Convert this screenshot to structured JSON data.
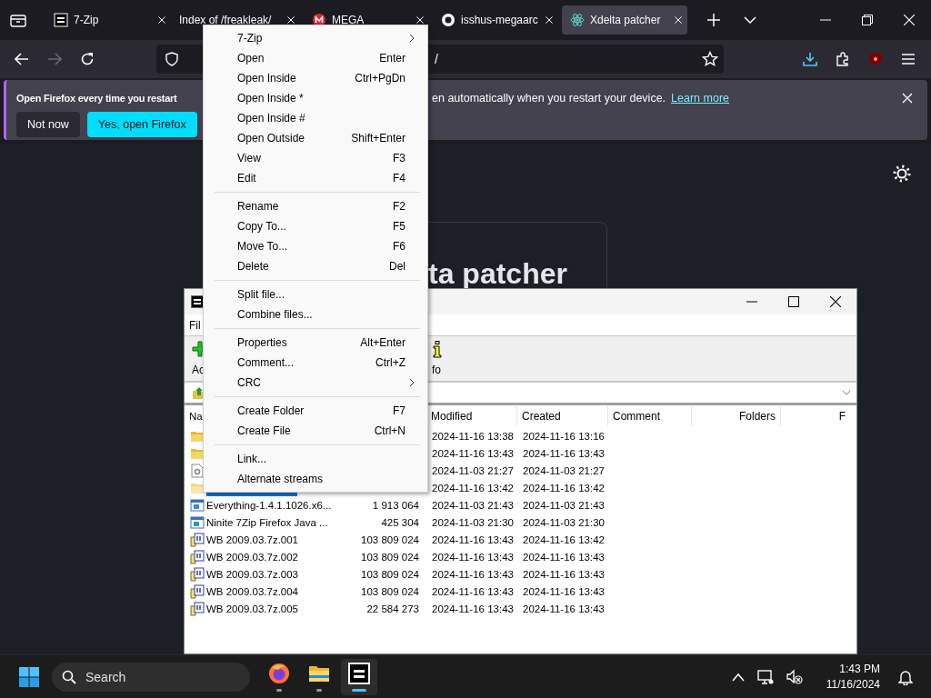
{
  "browser": {
    "tabs": [
      {
        "title": "7-Zip",
        "selected": false
      },
      {
        "title": "Index of /freakleak/",
        "selected": false
      },
      {
        "title": "MEGA",
        "selected": false
      },
      {
        "title": "isshus-megaarc",
        "selected": false
      },
      {
        "title": "Xdelta patcher",
        "selected": true
      }
    ],
    "forward_button": {
      "disabled": true
    },
    "url": "/",
    "notification": {
      "message_start": "Open Firefox every time you restart",
      "message_end": "en automatically when you restart your device.",
      "link": "Learn more",
      "buttons": [
        "Not now",
        "Yes, open Firefox"
      ]
    },
    "page": {
      "heading": "ta patcher"
    }
  },
  "archive_window": {
    "menu_bar": "Fil",
    "toolbar": [
      {
        "label": "Ac"
      },
      {
        "label": "fo"
      }
    ],
    "columns": [
      {
        "label": "Na"
      },
      {
        "label": "Modified"
      },
      {
        "label": "Created"
      },
      {
        "label": "Comment"
      },
      {
        "label": "Folders"
      },
      {
        "label": "F"
      }
    ],
    "rows": [
      {
        "kind": "folder",
        "modified": "2024-11-16 13:38",
        "created": "2024-11-16 13:16",
        "selected": false
      },
      {
        "kind": "folder",
        "modified": "2024-11-16 13:43",
        "created": "2024-11-16 13:43",
        "selected": false
      },
      {
        "kind": "settings-file",
        "modified": "2024-11-03 21:27",
        "created": "2024-11-03 21:27",
        "selected": false
      },
      {
        "kind": "folder",
        "modified": "2024-11-16 13:42",
        "created": "2024-11-16 13:42",
        "selected": true
      },
      {
        "kind": "program",
        "name": "Everything-1.4.1.1026.x6...",
        "size": "1 913 064",
        "modified": "2024-11-03 21:43",
        "created": "2024-11-03 21:43",
        "selected": false
      },
      {
        "kind": "program",
        "name": "Ninite 7Zip Firefox Java ...",
        "size": "425 304",
        "modified": "2024-11-03 21:30",
        "created": "2024-11-03 21:30",
        "selected": false
      },
      {
        "kind": "archive",
        "name": "WB 2009.03.7z.001",
        "size": "103 809 024",
        "modified": "2024-11-16 13:43",
        "created": "2024-11-16 13:42",
        "selected": false
      },
      {
        "kind": "archive",
        "name": "WB 2009.03.7z.002",
        "size": "103 809 024",
        "modified": "2024-11-16 13:43",
        "created": "2024-11-16 13:43",
        "selected": false
      },
      {
        "kind": "archive",
        "name": "WB 2009.03.7z.003",
        "size": "103 809 024",
        "modified": "2024-11-16 13:43",
        "created": "2024-11-16 13:43",
        "selected": false
      },
      {
        "kind": "archive",
        "name": "WB 2009.03.7z.004",
        "size": "103 809 024",
        "modified": "2024-11-16 13:43",
        "created": "2024-11-16 13:43",
        "selected": false
      },
      {
        "kind": "archive",
        "name": "WB 2009.03.7z.005",
        "size": "22 584 273",
        "modified": "2024-11-16 13:43",
        "created": "2024-11-16 13:43",
        "selected": false
      }
    ]
  },
  "context_menu": {
    "groups": [
      [
        {
          "label": "7-Zip",
          "submenu": true
        },
        {
          "label": "Open",
          "shortcut": "Enter"
        },
        {
          "label": "Open Inside",
          "shortcut": "Ctrl+PgDn"
        },
        {
          "label": "Open Inside *"
        },
        {
          "label": "Open Inside #"
        },
        {
          "label": "Open Outside",
          "shortcut": "Shift+Enter"
        },
        {
          "label": "View",
          "shortcut": "F3"
        },
        {
          "label": "Edit",
          "shortcut": "F4"
        }
      ],
      [
        {
          "label": "Rename",
          "shortcut": "F2"
        },
        {
          "label": "Copy To...",
          "shortcut": "F5"
        },
        {
          "label": "Move To...",
          "shortcut": "F6"
        },
        {
          "label": "Delete",
          "shortcut": "Del"
        }
      ],
      [
        {
          "label": "Split file..."
        },
        {
          "label": "Combine files..."
        }
      ],
      [
        {
          "label": "Properties",
          "shortcut": "Alt+Enter"
        },
        {
          "label": "Comment...",
          "shortcut": "Ctrl+Z"
        },
        {
          "label": "CRC",
          "submenu": true
        }
      ],
      [
        {
          "label": "Create Folder",
          "shortcut": "F7"
        },
        {
          "label": "Create File",
          "shortcut": "Ctrl+N"
        }
      ],
      [
        {
          "label": "Link..."
        },
        {
          "label": "Alternate streams"
        }
      ]
    ]
  },
  "taskbar": {
    "search_placeholder": "Search",
    "apps": [
      {
        "kind": "firefox",
        "active": false
      },
      {
        "kind": "folder",
        "active": false
      },
      {
        "kind": "archive",
        "active": true
      }
    ],
    "time": "1:43 PM",
    "date": "11/16/2024"
  }
}
